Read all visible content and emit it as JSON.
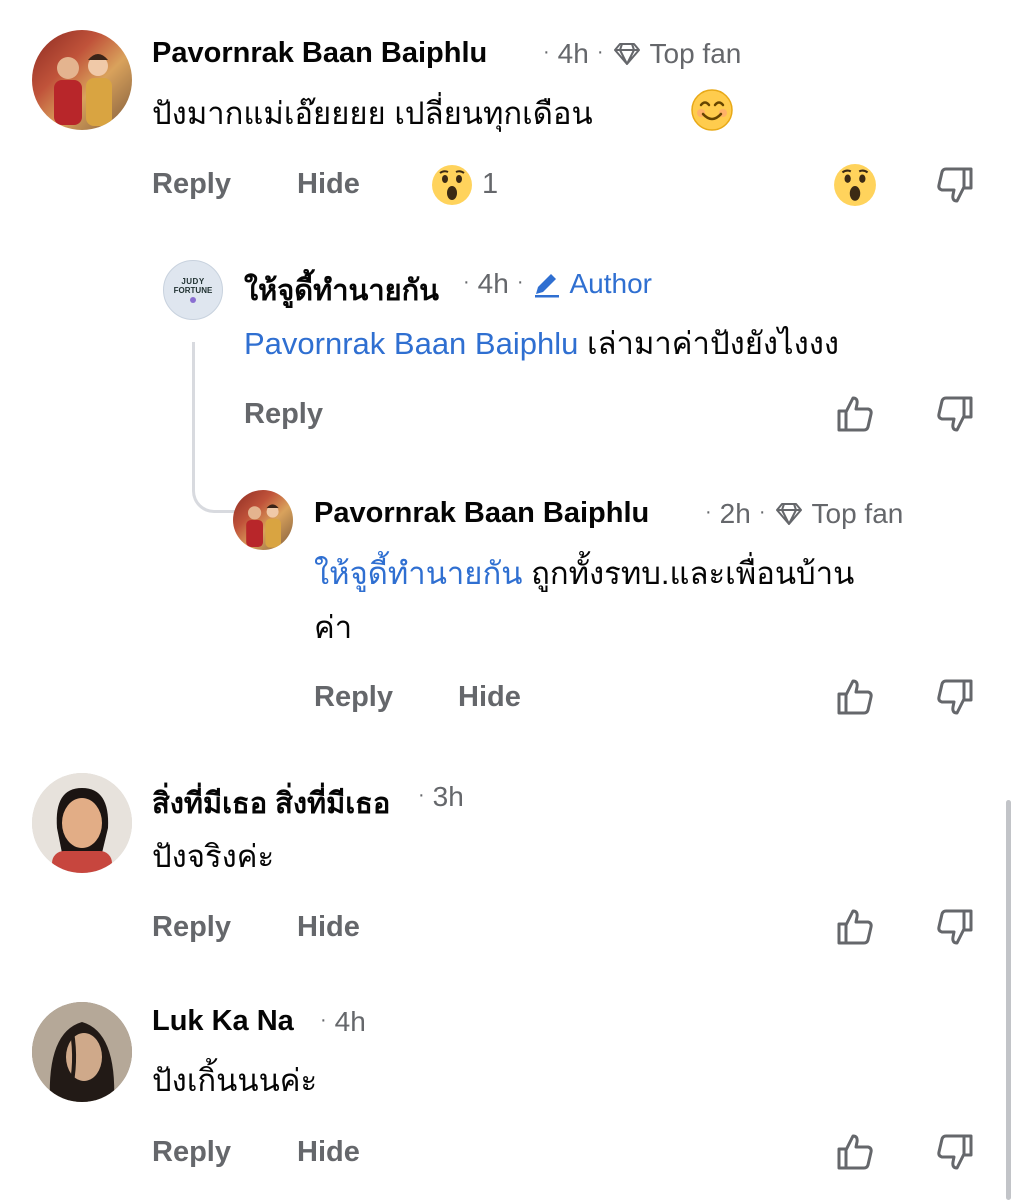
{
  "actions": {
    "reply": "Reply",
    "hide": "Hide"
  },
  "comments": [
    {
      "author": "Pavornrak Baan Baiphlu",
      "time": "4h",
      "badge": "Top fan",
      "text": "ปังมากแม่เอ๊ยยยย เปลี่ยนทุกเดือน",
      "reaction_count": "1"
    },
    {
      "author": "ให้จูดี้ทำนายกัน",
      "time": "4h",
      "badge": "Author",
      "avatar_text": [
        "JUDY",
        "FORTUNE"
      ],
      "mention": "Pavornrak Baan Baiphlu",
      "text": "เล่ามาค่าปังยังไงงง"
    },
    {
      "author": "Pavornrak Baan Baiphlu",
      "time": "2h",
      "badge": "Top fan",
      "mention": "ให้จูดี้ทำนายกัน",
      "text_line1": "ถูกทั้งรทบ.และเพื่อนบ้าน",
      "text_line2": "ค่า"
    },
    {
      "author": "สิ่งที่มีเธอ สิ่งที่มีเธอ",
      "time": "3h",
      "text": "ปังจริงค่ะ"
    },
    {
      "author": "Luk Ka Na",
      "time": "4h",
      "text": "ปังเกิ้นนนค่ะ"
    }
  ],
  "colors": {
    "mention": "#2f6fd1",
    "meta": "#65676b",
    "thread_line": "#d8dadf"
  }
}
